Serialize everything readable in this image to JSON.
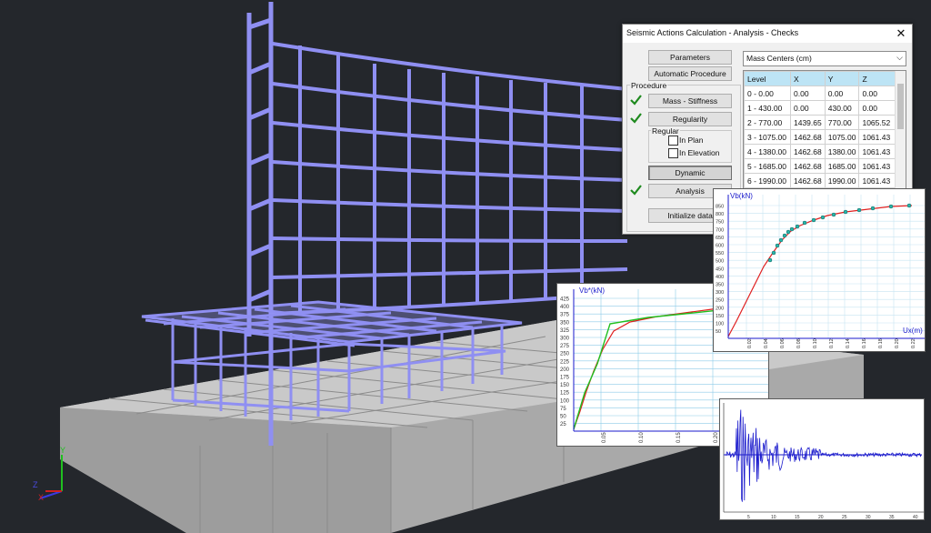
{
  "dialog": {
    "title": "Seismic Actions Calculation - Analysis - Checks",
    "buttons": {
      "parameters": "Parameters",
      "automatic": "Automatic Procedure",
      "mass_stiffness": "Mass - Stiffness",
      "regularity": "Regularity",
      "dynamic": "Dynamic",
      "analysis": "Analysis",
      "initialize": "Initialize data"
    },
    "procedure_label": "Procedure",
    "regular_label": "Regular",
    "in_plan": "In Plan",
    "in_elevation": "In Elevation",
    "dropdown_value": "Mass Centers (cm)",
    "close_glyph": "✕",
    "dropdown_glyph": "⌵",
    "table": {
      "columns": [
        "Level",
        "X",
        "Y",
        "Z"
      ],
      "rows": [
        [
          "0 - 0.00",
          "0.00",
          "0.00",
          "0.00"
        ],
        [
          "1 - 430.00",
          "0.00",
          "430.00",
          "0.00"
        ],
        [
          "2 - 770.00",
          "1439.65",
          "770.00",
          "1065.52"
        ],
        [
          "3 - 1075.00",
          "1462.68",
          "1075.00",
          "1061.43"
        ],
        [
          "4 - 1380.00",
          "1462.68",
          "1380.00",
          "1061.43"
        ],
        [
          "5 - 1685.00",
          "1462.68",
          "1685.00",
          "1061.43"
        ],
        [
          "6 - 1990.00",
          "1462.68",
          "1990.00",
          "1061.43"
        ]
      ]
    },
    "check_color": "#1e8a1e"
  },
  "charts": {
    "small": {
      "ylabel": "Vb*(kN)",
      "yticks": [
        "425",
        "400",
        "375",
        "350",
        "325",
        "300",
        "275",
        "250",
        "225",
        "200",
        "175",
        "150",
        "125",
        "100",
        "75",
        "50",
        "25"
      ],
      "xticks": [
        "0.05",
        "0.10",
        "0.15",
        "0.20"
      ]
    },
    "large": {
      "ylabel": "Vb(kN)",
      "xlabel": "Ux(m)",
      "yticks": [
        "850",
        "800",
        "750",
        "700",
        "650",
        "600",
        "550",
        "500",
        "450",
        "400",
        "350",
        "300",
        "250",
        "200",
        "150",
        "100",
        "50"
      ],
      "xticks": [
        "0.02",
        "0.04",
        "0.06",
        "0.08",
        "0.10",
        "0.12",
        "0.14",
        "0.16",
        "0.18",
        "0.20",
        "0.22",
        "0.24"
      ]
    },
    "history": {
      "xticks": [
        "5",
        "10",
        "15",
        "20",
        "25",
        "30",
        "35",
        "40"
      ],
      "yticks": [
        "-20",
        "-10",
        "0",
        "10"
      ]
    }
  },
  "axes": {
    "y": "Y",
    "z": "Z",
    "x": "X"
  },
  "colors": {
    "background": "#24272c",
    "frame": "#8f8ff2",
    "slab": "#b9b9b9",
    "curve_red": "#e02020",
    "curve_green": "#20c020",
    "history_blue": "#1a1acc"
  }
}
